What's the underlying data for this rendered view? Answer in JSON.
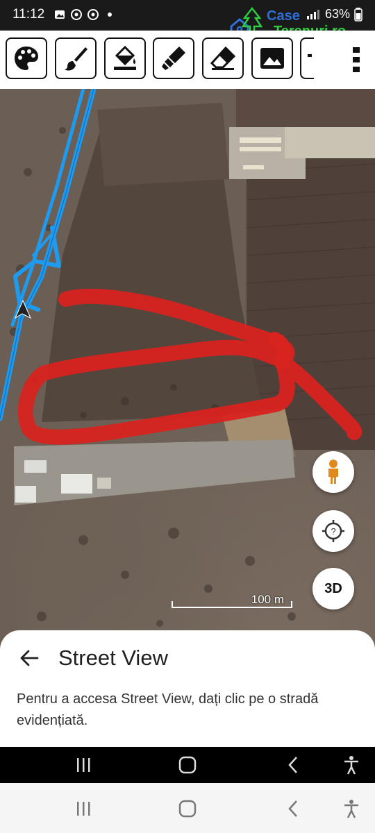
{
  "status_bar": {
    "time": "11:12",
    "battery_text": "63%",
    "left_icons": [
      "gallery-icon",
      "chrome-icon",
      "chrome-icon",
      "dot-icon"
    ]
  },
  "watermark": {
    "line1": "Case",
    "line2": "Terenuri.ro"
  },
  "toolbar": {
    "tools": [
      "palette-icon",
      "brush-icon",
      "paint-bucket-icon",
      "highlighter-icon",
      "eraser-icon",
      "image-icon"
    ]
  },
  "map": {
    "scale_label": "100 m",
    "fab_3d_label": "3D",
    "road_color": "#1e9bef",
    "annotation_color": "#d8231f"
  },
  "street_view_sheet": {
    "title": "Street View",
    "description": "Pentru a accesa Street View, dați clic pe o stradă evidențiată."
  }
}
